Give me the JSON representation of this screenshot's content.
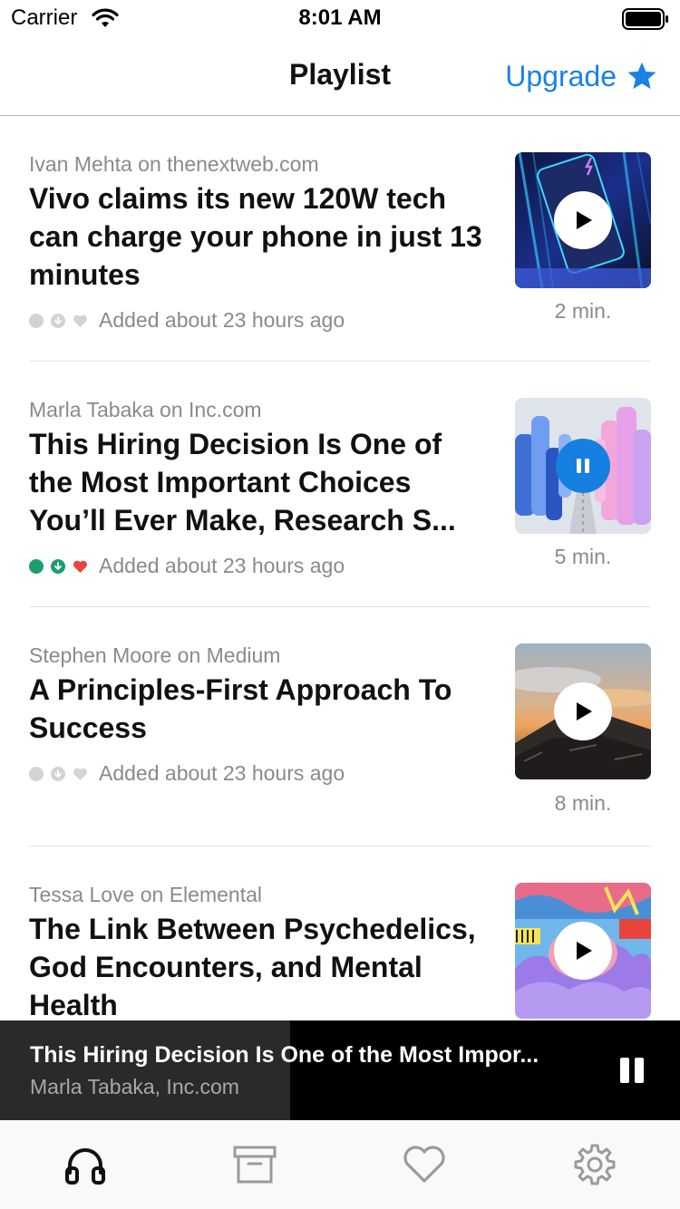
{
  "status_bar": {
    "carrier": "Carrier",
    "time": "8:01 AM",
    "icons": [
      "wifi-icon",
      "battery-icon"
    ]
  },
  "nav": {
    "title": "Playlist",
    "upgrade_label": "Upgrade",
    "upgrade_icon": "star-icon"
  },
  "colors": {
    "accent": "#1a82e2",
    "played_green": "#1a9e6e",
    "liked_red": "#e8453c",
    "inactive_gray": "#d3d3d3",
    "text_secondary": "#8a8a8a",
    "player_bg": "#000000",
    "player_progress": "#2a2a2a"
  },
  "articles": [
    {
      "source": "Ivan Mehta on thenextweb.com",
      "title": "Vivo claims its new 120W tech can charge your phone in just 13 minutes",
      "added": "Added about 23 hours ago",
      "duration": "2 min.",
      "state": "play",
      "status": {
        "played": false,
        "downloaded": false,
        "liked": false
      }
    },
    {
      "source": "Marla Tabaka on Inc.com",
      "title": "This Hiring Decision Is One of the Most Important Choices You’ll Ever Make, Research S...",
      "added": "Added about 23 hours ago",
      "duration": "5 min.",
      "state": "pause",
      "status": {
        "played": true,
        "downloaded": true,
        "liked": true
      }
    },
    {
      "source": "Stephen Moore on Medium",
      "title": "A Principles-First Approach To Success",
      "added": "Added about 23 hours ago",
      "duration": "8 min.",
      "state": "play",
      "status": {
        "played": false,
        "downloaded": false,
        "liked": false
      }
    },
    {
      "source": "Tessa Love on Elemental",
      "title": "The Link Between Psychedelics, God Encounters, and Mental Health",
      "state": "play"
    }
  ],
  "now_playing": {
    "title": "This Hiring Decision Is One of the Most Impor...",
    "subtitle": "Marla Tabaka, Inc.com",
    "progress": 0.427,
    "icon": "pause-icon"
  },
  "tabs": [
    {
      "name": "playlist",
      "icon": "headphones-icon",
      "active": true
    },
    {
      "name": "archive",
      "icon": "archive-box-icon",
      "active": false
    },
    {
      "name": "favorites",
      "icon": "heart-icon",
      "active": false
    },
    {
      "name": "settings",
      "icon": "gear-icon",
      "active": false
    }
  ]
}
